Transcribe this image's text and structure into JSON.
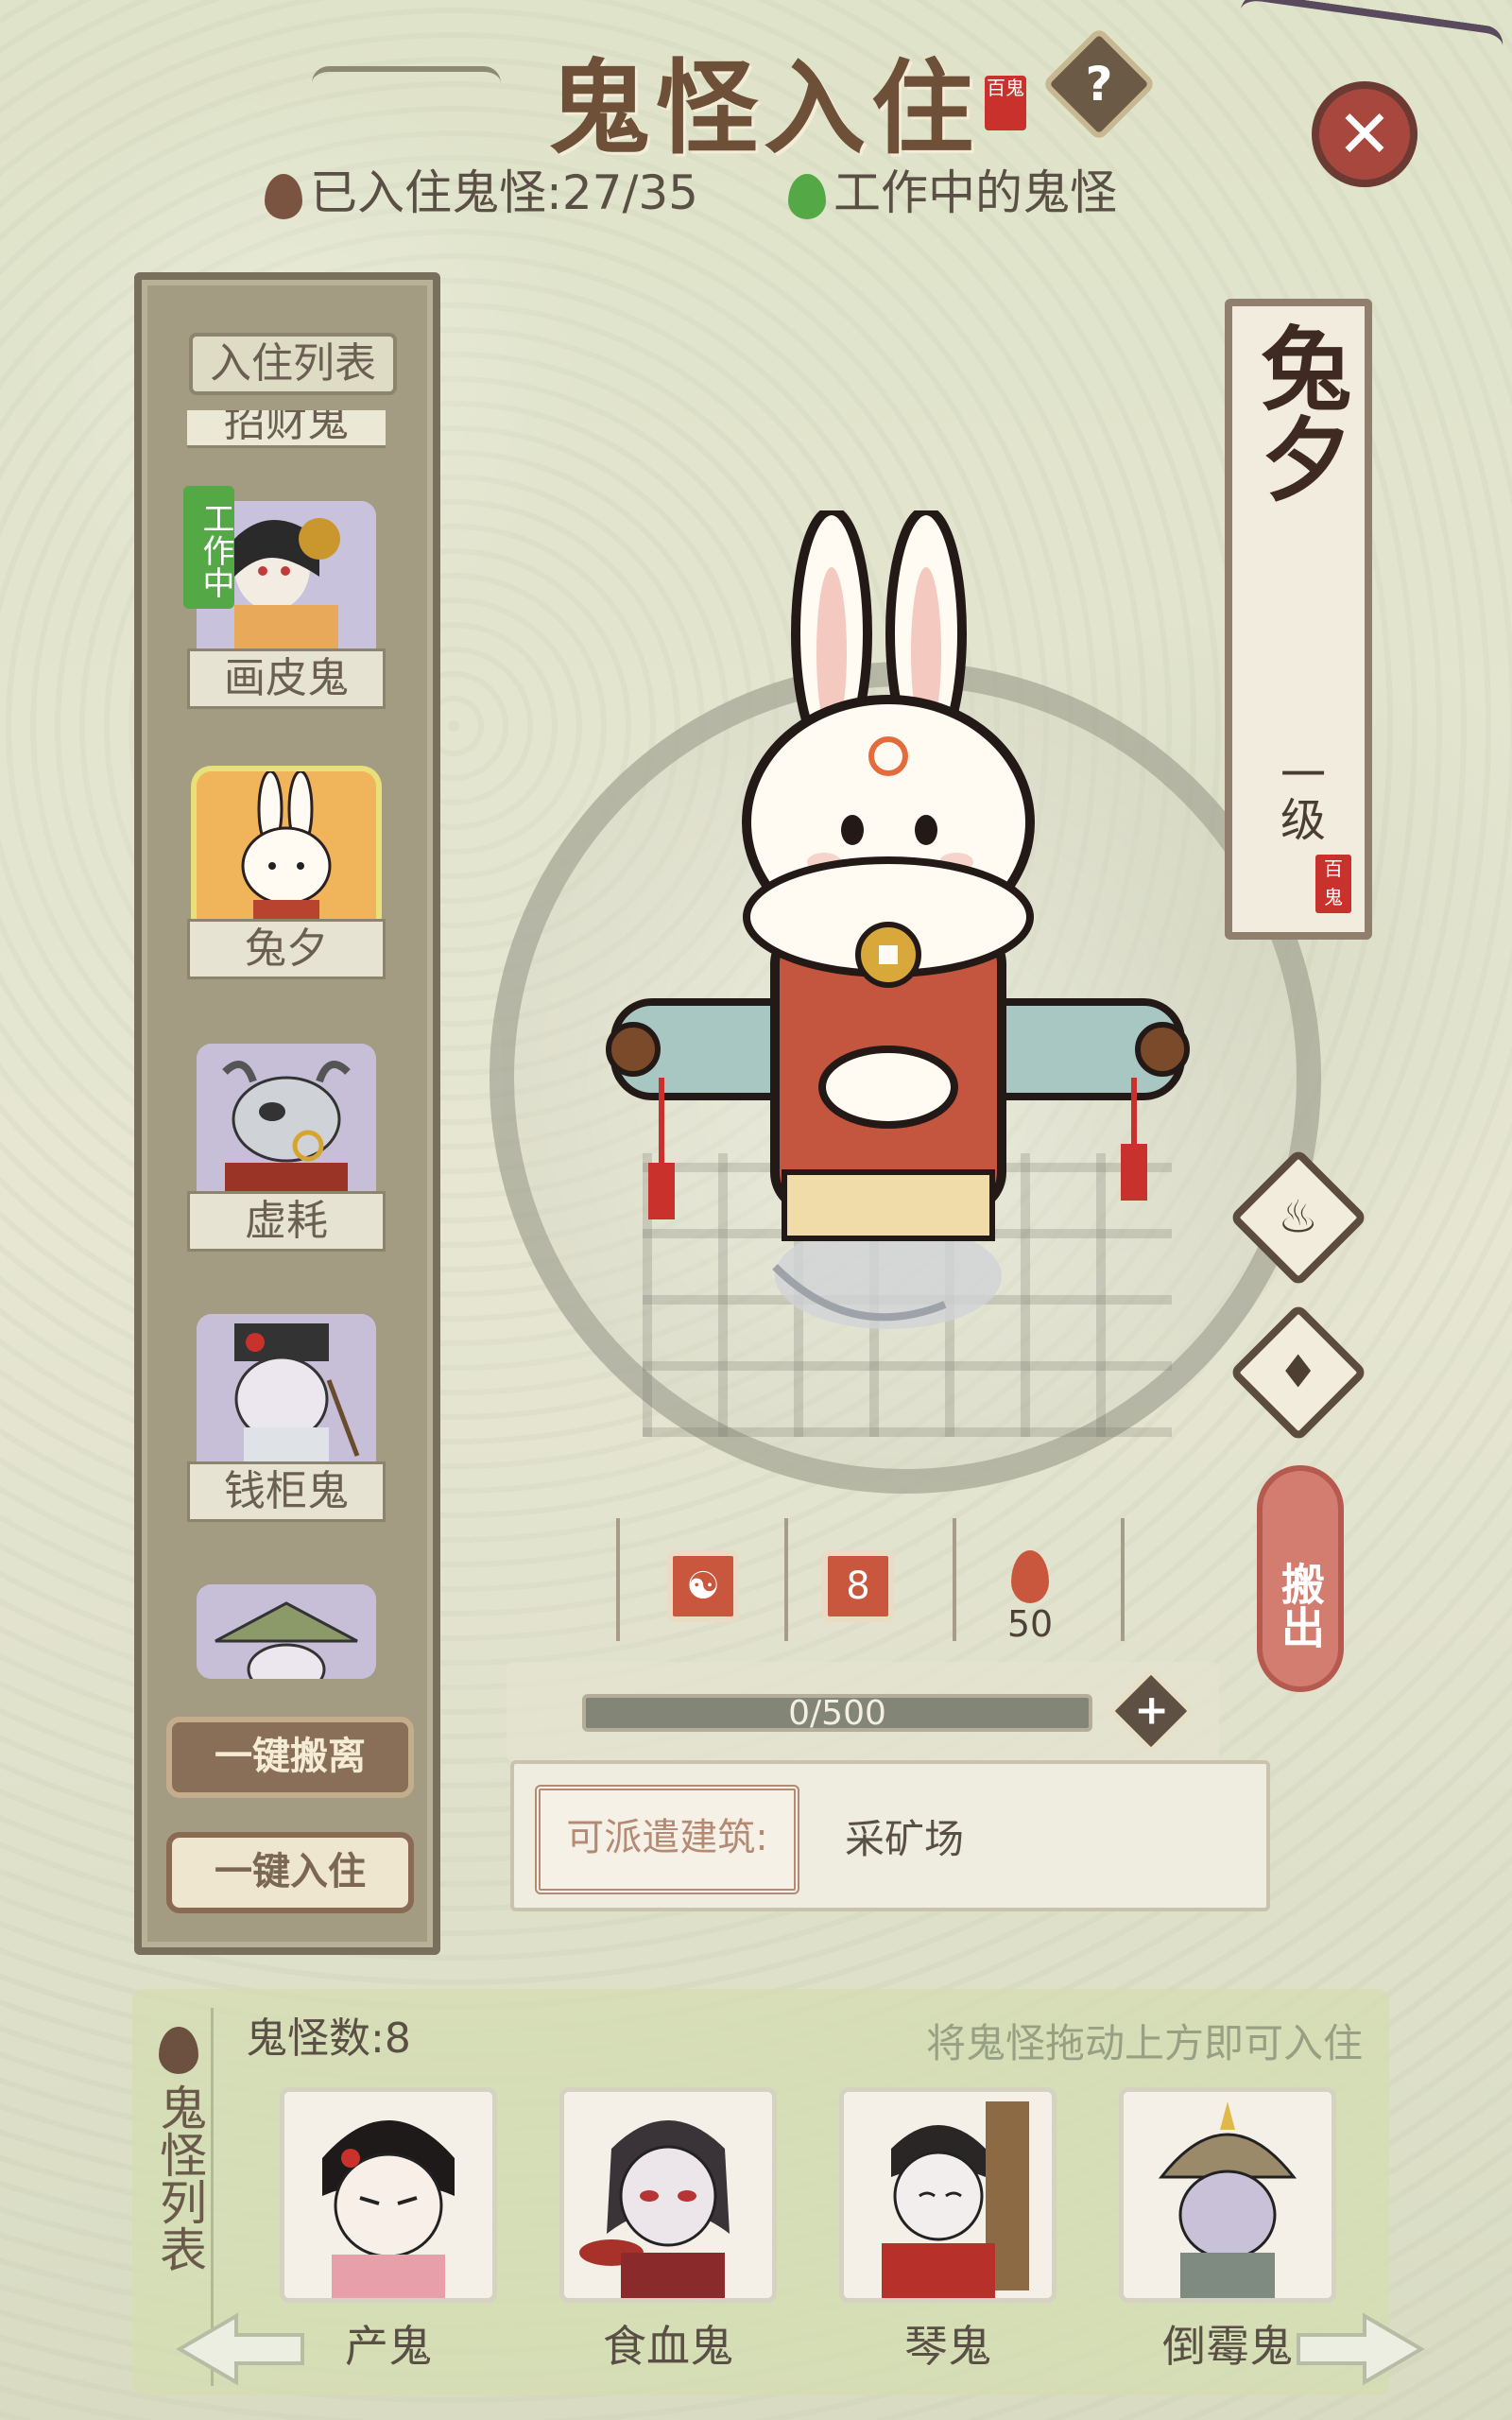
{
  "header": {
    "title": "鬼怪入住",
    "seal_text": "百鬼",
    "help_label": "?",
    "close_label": "✕",
    "resident_stat": "已入住鬼怪:27/35",
    "working_stat": "工作中的鬼怪"
  },
  "resident_list": {
    "title": "入住列表",
    "cut_label": "招财鬼",
    "items": [
      {
        "name": "画皮鬼",
        "tag": "工作中"
      },
      {
        "name": "兔夕"
      },
      {
        "name": "虚耗"
      },
      {
        "name": "钱柜鬼"
      }
    ],
    "btn_remove_all": "一键搬离",
    "btn_add_all": "一键入住"
  },
  "selected": {
    "name": "兔夕",
    "level": "一级",
    "seal": "百鬼",
    "stat_badge": "8",
    "stat_fire": "50",
    "xp_text": "0/500",
    "xp_fraction": 0.0,
    "assign_label": "可派遣建筑:",
    "assign_value": "采矿场",
    "move_out": "搬出"
  },
  "roster": {
    "side_title": "鬼怪列表",
    "count": "鬼怪数:8",
    "hint": "将鬼怪拖动上方即可入住",
    "cards": [
      {
        "name": "产鬼"
      },
      {
        "name": "食血鬼"
      },
      {
        "name": "琴鬼"
      },
      {
        "name": "倒霉鬼"
      }
    ]
  },
  "colors": {
    "accent": "#6e4f38",
    "working_green": "#54a845",
    "move_out_red": "#d27d70"
  }
}
